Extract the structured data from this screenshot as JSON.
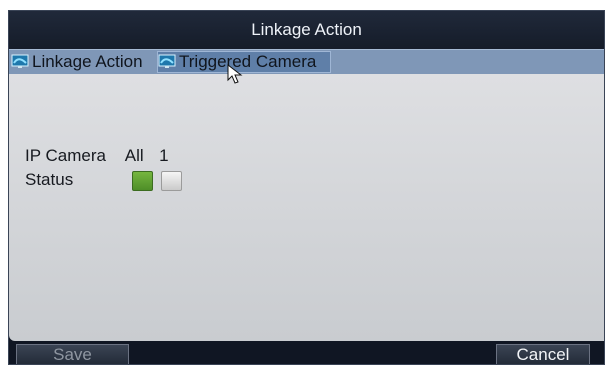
{
  "window": {
    "title": "Linkage Action"
  },
  "tabs": [
    {
      "label": "Linkage Action",
      "icon": "monitor-icon",
      "active": false
    },
    {
      "label": "Triggered Camera",
      "icon": "monitor-icon",
      "active": true
    }
  ],
  "settings": {
    "camera_label": "IP Camera",
    "camera_values": [
      "All",
      "1"
    ],
    "status_label": "Status",
    "status_states": [
      {
        "name": "All",
        "checked": true,
        "color": "#5f9f31"
      },
      {
        "name": "1",
        "checked": false,
        "color": "#d8d8d8"
      }
    ]
  },
  "buttons": {
    "save": {
      "label": "Save",
      "enabled": false
    },
    "cancel": {
      "label": "Cancel",
      "enabled": true
    }
  },
  "colors": {
    "title_bar": "#20293a",
    "tab_strip": "#7f97b7",
    "active_tab": "#5f7fa8",
    "panel": "#d6d8dc",
    "enabled_status": "#5f9f31",
    "disabled_status": "#d8d8d8"
  }
}
